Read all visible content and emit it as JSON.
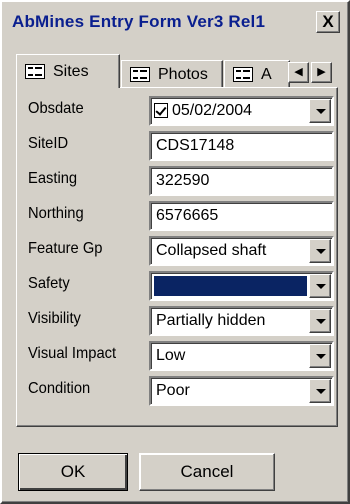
{
  "window": {
    "title": "AbMines Entry Form Ver3 Rel1",
    "close_label": "X"
  },
  "tabs": [
    {
      "label": "Sites",
      "icon": "form-icon",
      "active": true
    },
    {
      "label": "Photos",
      "icon": "form-icon",
      "active": false
    },
    {
      "label": "A",
      "icon": "form-icon",
      "active": false
    }
  ],
  "tab_scroll": {
    "left": "◀",
    "right": "▶"
  },
  "form": {
    "obsdate": {
      "label": "Obsdate",
      "value": "05/02/2004",
      "checked": true
    },
    "siteid": {
      "label": "SiteID",
      "value": "CDS17148"
    },
    "easting": {
      "label": "Easting",
      "value": "322590"
    },
    "northing": {
      "label": "Northing",
      "value": "6576665"
    },
    "feature_gp": {
      "label": "Feature Gp",
      "value": "Collapsed shaft"
    },
    "safety": {
      "label": "Safety",
      "value": "",
      "swatch_color": "#0a2463"
    },
    "visibility": {
      "label": "Visibility",
      "value": "Partially hidden"
    },
    "visual_impact": {
      "label": "Visual Impact",
      "value": "Low"
    },
    "condition": {
      "label": "Condition",
      "value": "Poor"
    }
  },
  "buttons": {
    "ok": "OK",
    "cancel": "Cancel"
  }
}
